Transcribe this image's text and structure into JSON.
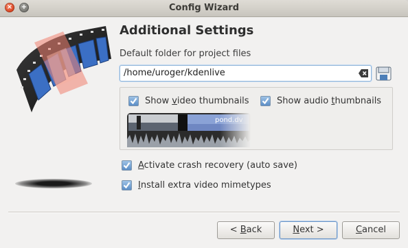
{
  "window": {
    "title": "Config Wizard"
  },
  "page": {
    "heading": "Additional Settings",
    "folder_label": "Default folder for project files",
    "folder_value": "/home/uroger/kdenlive"
  },
  "options": {
    "video_thumbs": {
      "pre": "Show ",
      "u": "v",
      "post": "ideo thumbnails",
      "checked": true
    },
    "audio_thumbs": {
      "pre": "Show audio ",
      "u": "t",
      "post": "humbnails",
      "checked": true
    },
    "thumb_clip_name": "pond.dv",
    "crash_recovery": {
      "pre": "",
      "u": "A",
      "post": "ctivate crash recovery (auto save)",
      "checked": true
    },
    "mimetypes": {
      "pre": "",
      "u": "I",
      "post": "nstall extra video mimetypes",
      "checked": true
    }
  },
  "buttons": {
    "back": {
      "pre": "< ",
      "u": "B",
      "post": "ack"
    },
    "next": {
      "pre": "",
      "u": "N",
      "post": "ext >"
    },
    "cancel": {
      "pre": "",
      "u": "C",
      "post": "ancel"
    }
  },
  "icons": {
    "close": "close-icon",
    "maximize": "maximize-icon",
    "clear": "clear-text-icon",
    "folder": "folder-icon",
    "checkbox": "checkmark-icon",
    "logo": "film-strip-icon"
  },
  "colors": {
    "accent": "#5b8dc6",
    "close_button": "#d8411e"
  }
}
